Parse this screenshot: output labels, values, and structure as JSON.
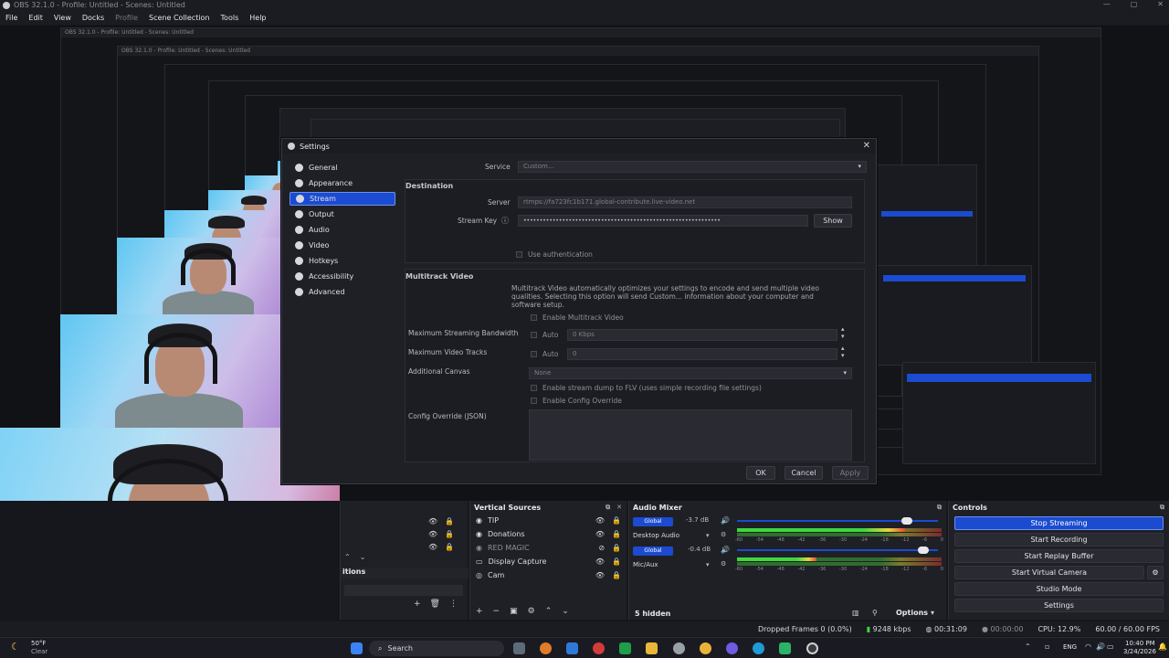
{
  "window": {
    "title": "OBS 32.1.0 - Profile: Untitled - Scenes: Untitled",
    "controls": [
      "—",
      "▢",
      "✕"
    ]
  },
  "menu": [
    "File",
    "Edit",
    "View",
    "Docks",
    "Profile",
    "Scene Collection",
    "Tools",
    "Help"
  ],
  "settings": {
    "title": "Settings",
    "close": "✕",
    "sidebar": [
      {
        "label": "General",
        "icon": "gear-icon"
      },
      {
        "label": "Appearance",
        "icon": "palette-icon"
      },
      {
        "label": "Stream",
        "icon": "antenna-icon"
      },
      {
        "label": "Output",
        "icon": "output-icon"
      },
      {
        "label": "Audio",
        "icon": "speaker-icon"
      },
      {
        "label": "Video",
        "icon": "monitor-icon"
      },
      {
        "label": "Hotkeys",
        "icon": "keyboard-icon"
      },
      {
        "label": "Accessibility",
        "icon": "accessibility-icon"
      },
      {
        "label": "Advanced",
        "icon": "wrench-icon"
      }
    ],
    "service_label": "Service",
    "service_value": "Custom...",
    "destination_title": "Destination",
    "server_label": "Server",
    "server_value": "rtmps://fa723fc1b171.global-contribute.live-video.net",
    "stream_key_label": "Stream Key",
    "stream_key_value": "•••••••••••••••••••••••••••••••••••••••••••••••••••••••••••••",
    "show_button": "Show",
    "use_auth": "Use authentication",
    "multitrack_title": "Multitrack Video",
    "multitrack_desc": "Multitrack Video automatically optimizes your settings to encode and send multiple video qualities. Selecting this option will send Custom... information about your computer and software setup.",
    "enable_multitrack": "Enable Multitrack Video",
    "max_bandwidth_label": "Maximum Streaming Bandwidth",
    "max_bandwidth_auto": "Auto",
    "max_bandwidth_value": "0 Kbps",
    "max_tracks_label": "Maximum Video Tracks",
    "max_tracks_auto": "Auto",
    "max_tracks_value": "0",
    "additional_canvas_label": "Additional Canvas",
    "additional_canvas_value": "None",
    "stream_dump": "Enable stream dump to FLV (uses simple recording file settings)",
    "config_override": "Enable Config Override",
    "config_override_json": "Config Override (JSON)",
    "ok": "OK",
    "cancel": "Cancel",
    "apply": "Apply"
  },
  "transitions_dock": {
    "title": "itions"
  },
  "vertical_sources": {
    "title": "Vertical Sources",
    "items": [
      "TIP",
      "Donations",
      "RED MAGIC",
      "Display Capture",
      "Cam"
    ]
  },
  "audio_mixer": {
    "title": "Audio Mixer",
    "channels": [
      {
        "name": "Desktop Audio",
        "badge": "Global",
        "db": "-3.7 dB",
        "level": 0.82
      },
      {
        "name": "Mic/Aux",
        "badge": "Global",
        "db": "-0.4 dB",
        "level": 0.39
      }
    ],
    "scale": [
      "-60",
      "-54",
      "-48",
      "-42",
      "-36",
      "-30",
      "-24",
      "-18",
      "-12",
      "-6",
      "0"
    ],
    "hidden": "5 hidden",
    "options": "Options"
  },
  "controls": {
    "title": "Controls",
    "buttons": [
      "Stop Streaming",
      "Start Recording",
      "Start Replay Buffer",
      "Start Virtual Camera",
      "Studio Mode",
      "Settings"
    ]
  },
  "status": {
    "dropped": "Dropped Frames 0 (0.0%)",
    "bitrate": "9248 kbps",
    "stream_time": "00:31:09",
    "rec_time": "00:00:00",
    "cpu": "CPU: 12.9%",
    "fps": "60.00 / 60.00 FPS"
  },
  "taskbar": {
    "weather_temp": "50°F",
    "weather_desc": "Clear",
    "search": "Search",
    "lang": "ENG",
    "time": "10:40 PM",
    "date": "3/24/2026"
  },
  "nested_title": "OBS 32.1.0 - Profile: Untitled - Scenes: Untitled"
}
